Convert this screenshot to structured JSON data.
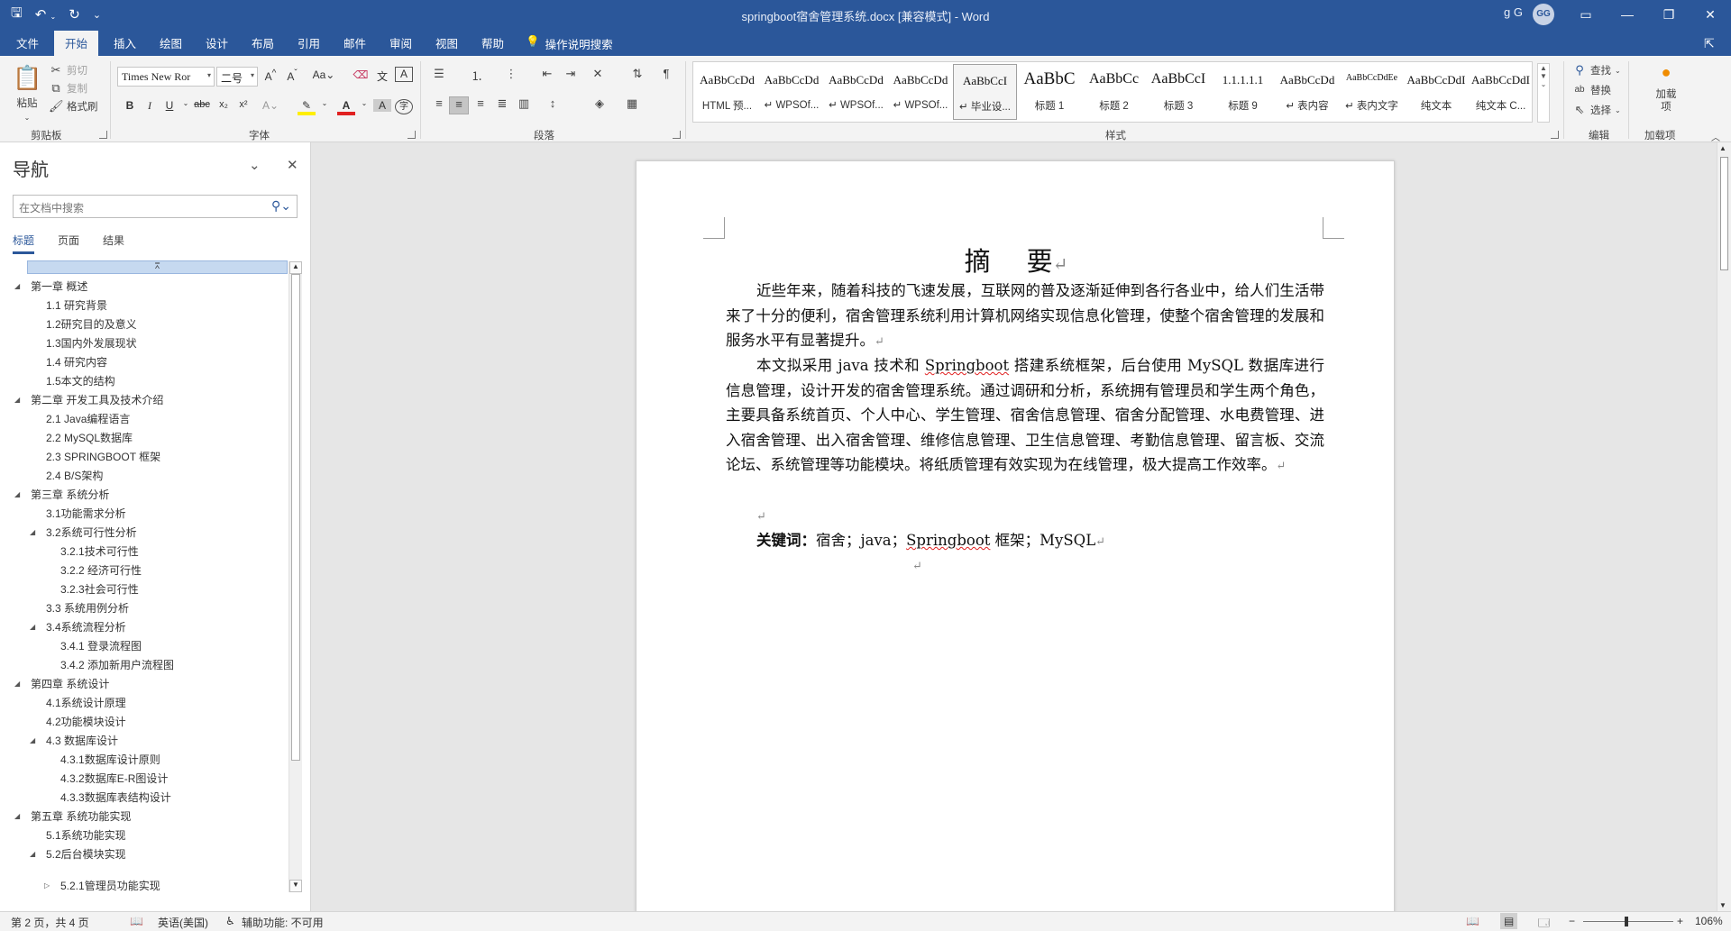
{
  "window": {
    "title": "springboot宿舍管理系统.docx [兼容模式] - Word",
    "user_name": "g G",
    "user_initials": "GG"
  },
  "qat": {
    "save_icon": "save-icon",
    "undo_icon": "undo-icon",
    "redo_icon": "redo-icon",
    "customize_icon": "customize-icon"
  },
  "tabs": [
    "文件",
    "开始",
    "插入",
    "绘图",
    "设计",
    "布局",
    "引用",
    "邮件",
    "审阅",
    "视图",
    "帮助"
  ],
  "active_tab": "开始",
  "tell_me": "操作说明搜索",
  "clipboard": {
    "paste": "粘贴",
    "cut": "剪切",
    "copy": "复制",
    "format_painter": "格式刷",
    "label": "剪贴板"
  },
  "font": {
    "name": "Times New Ror",
    "size": "二号",
    "label": "字体"
  },
  "paragraph": {
    "label": "段落"
  },
  "styles": {
    "label": "样式",
    "items": [
      {
        "sample": "AaBbCcDd",
        "name": "HTML 预..."
      },
      {
        "sample": "AaBbCcDd",
        "name": "↵ WPSOf..."
      },
      {
        "sample": "AaBbCcDd",
        "name": "↵ WPSOf..."
      },
      {
        "sample": "AaBbCcDd",
        "name": "↵ WPSOf..."
      },
      {
        "sample": "AaBbCcI",
        "name": "↵ 毕业设..."
      },
      {
        "sample": "AaBbC",
        "name": "标题 1"
      },
      {
        "sample": "AaBbCc",
        "name": "标题 2"
      },
      {
        "sample": "AaBbCcI",
        "name": "标题 3"
      },
      {
        "sample": "1.1.1.1.1",
        "name": "标题 9"
      },
      {
        "sample": "AaBbCcDd",
        "name": "↵ 表内容"
      },
      {
        "sample": "AaBbCcDdEe",
        "name": "↵ 表内文字"
      },
      {
        "sample": "AaBbCcDdI",
        "name": "纯文本"
      },
      {
        "sample": "AaBbCcDdI",
        "name": "纯文本 C..."
      }
    ],
    "selected_index": 4
  },
  "editing": {
    "find": "查找",
    "replace": "替换",
    "select": "选择",
    "label": "编辑"
  },
  "addins": {
    "button": "加载项",
    "label": "加载项"
  },
  "nav": {
    "title": "导航",
    "search_placeholder": "在文档中搜索",
    "tabs": [
      "标题",
      "页面",
      "结果"
    ],
    "items": [
      {
        "text": "第一章 概述",
        "level": 1,
        "twisty": "◢"
      },
      {
        "text": "1.1 研究背景",
        "level": 2,
        "twisty": ""
      },
      {
        "text": "1.2研究目的及意义",
        "level": 2,
        "twisty": ""
      },
      {
        "text": "1.3国内外发展现状",
        "level": 2,
        "twisty": ""
      },
      {
        "text": "1.4 研究内容",
        "level": 2,
        "twisty": ""
      },
      {
        "text": "1.5本文的结构",
        "level": 2,
        "twisty": ""
      },
      {
        "text": " 第二章 开发工具及技术介绍",
        "level": 1,
        "twisty": "◢"
      },
      {
        "text": "2.1 Java编程语言",
        "level": 2,
        "twisty": ""
      },
      {
        "text": " 2.2 MySQL数据库",
        "level": 2,
        "twisty": ""
      },
      {
        "text": "2.3 SPRINGBOOT 框架",
        "level": 2,
        "twisty": ""
      },
      {
        "text": "2.4 B/S架构",
        "level": 2,
        "twisty": ""
      },
      {
        "text": "第三章 系统分析",
        "level": 1,
        "twisty": "◢"
      },
      {
        "text": "3.1功能需求分析",
        "level": 2,
        "twisty": ""
      },
      {
        "text": "3.2系统可行性分析",
        "level": 2,
        "twisty": "◢"
      },
      {
        "text": "3.2.1技术可行性",
        "level": 3,
        "twisty": ""
      },
      {
        "text": "3.2.2 经济可行性",
        "level": 3,
        "twisty": ""
      },
      {
        "text": "3.2.3社会可行性",
        "level": 3,
        "twisty": ""
      },
      {
        "text": "3.3 系统用例分析",
        "level": 2,
        "twisty": ""
      },
      {
        "text": "3.4系统流程分析",
        "level": 2,
        "twisty": "◢"
      },
      {
        "text": "3.4.1 登录流程图",
        "level": 3,
        "twisty": ""
      },
      {
        "text": "3.4.2 添加新用户流程图",
        "level": 3,
        "twisty": ""
      },
      {
        "text": "第四章 系统设计",
        "level": 1,
        "twisty": "◢"
      },
      {
        "text": "4.1系统设计原理",
        "level": 2,
        "twisty": ""
      },
      {
        "text": "4.2功能模块设计",
        "level": 2,
        "twisty": ""
      },
      {
        "text": "4.3 数据库设计",
        "level": 2,
        "twisty": "◢"
      },
      {
        "text": "4.3.1数据库设计原则",
        "level": 3,
        "twisty": ""
      },
      {
        "text": " 4.3.2数据库E-R图设计",
        "level": 3,
        "twisty": ""
      },
      {
        "text": "4.3.3数据库表结构设计",
        "level": 3,
        "twisty": ""
      },
      {
        "text": "第五章 系统功能实现",
        "level": 1,
        "twisty": "◢"
      },
      {
        "text": "5.1系统功能实现",
        "level": 2,
        "twisty": ""
      },
      {
        "text": "5.2后台模块实现",
        "level": 2,
        "twisty": "◢"
      },
      {
        "text": "5.2.1管理员功能实现",
        "level": 3,
        "twisty": "▷"
      }
    ]
  },
  "document": {
    "heading_left": "摘",
    "heading_right": "要",
    "para1": "近些年来，随着科技的飞速发展，互联网的普及逐渐延伸到各行各业中，给人们生活带来了十分的便利，宿舍管理系统利用计算机网络实现信息化管理，使整个宿舍管理的发展和服务水平有显著提升。",
    "para2_pre": "本文拟采用 java 技术和 ",
    "para2_sq": "Springboot",
    "para2_post": " 搭建系统框架，后台使用 MySQL 数据库进行信息管理，设计开发的宿舍管理系统。通过调研和分析，系统拥有管理员和学生两个角色，主要具备系统首页、个人中心、学生管理、宿舍信息管理、宿舍分配管理、水电费管理、进入宿舍管理、出入宿舍管理、维修信息管理、卫生信息管理、考勤信息管理、留言板、交流论坛、系统管理等功能模块。将纸质管理有效实现为在线管理，极大提高工作效率。",
    "kw_label": "关键词：",
    "kw_pre": "宿舍；java；",
    "kw_sq": "Springboot",
    "kw_post": " 框架；MySQL",
    "para_mark": "↵"
  },
  "status": {
    "page": "第 2 页，共 4 页",
    "language": "英语(美国)",
    "accessibility": "辅助功能: 不可用",
    "zoom": "106%"
  }
}
